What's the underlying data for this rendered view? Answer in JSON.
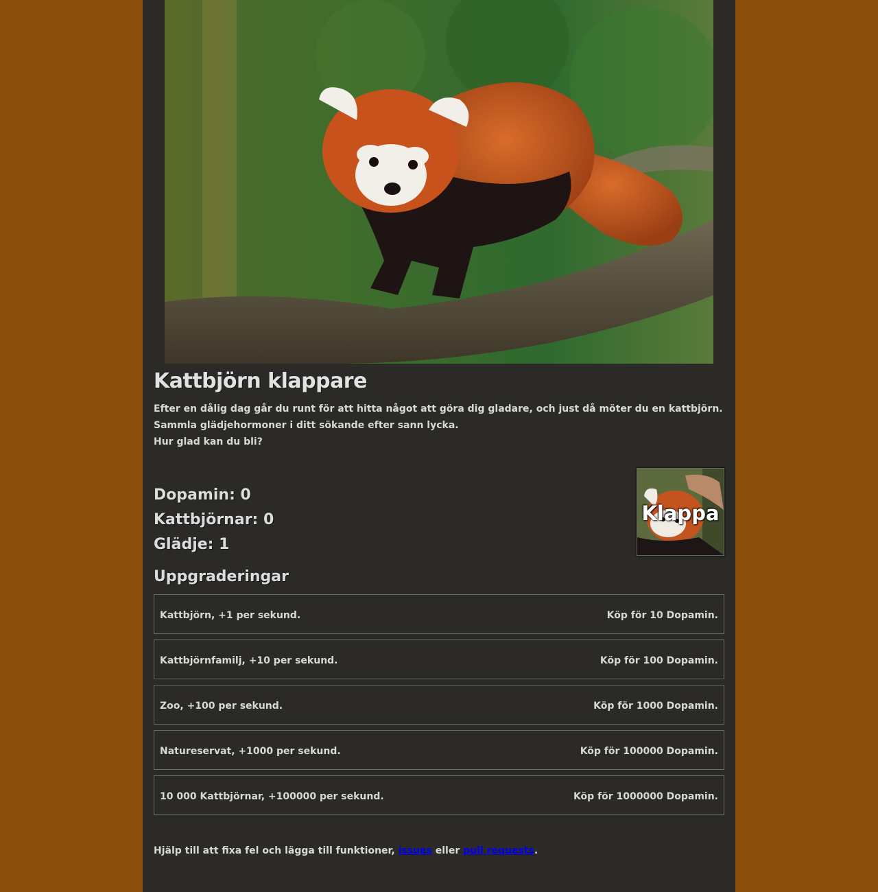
{
  "hero": {
    "image_description_icon": "red-panda-on-branch-photo"
  },
  "header": {
    "title": "Kattbjörn klappare"
  },
  "intro": {
    "lines": [
      "Efter en dålig dag går du runt för att hitta något att göra dig gladare, och just då möter du en kattbjörn.",
      "Sammla glädjehormoner i ditt sökande efter sann lycka.",
      "Hur glad kan du bli?"
    ]
  },
  "stats": {
    "dopamin": "Dopamin: 0",
    "kattbjornar": "Kattbjörnar: 0",
    "gladje": "Glädje: 1"
  },
  "pet_button": {
    "label": "Klappa"
  },
  "upgrades": {
    "title": "Uppgraderingar",
    "items": [
      {
        "name": "Kattbjörn, +1 per sekund.",
        "price": "Köp för 10 Dopamin."
      },
      {
        "name": "Kattbjörnfamilj, +10 per sekund.",
        "price": "Köp för 100 Dopamin."
      },
      {
        "name": "Zoo, +100 per sekund.",
        "price": "Köp för 1000 Dopamin."
      },
      {
        "name": "Natureservat, +1000 per sekund.",
        "price": "Köp för 100000 Dopamin."
      },
      {
        "name": "10 000 Kattbjörnar, +100000 per sekund.",
        "price": "Köp för 1000000 Dopamin."
      }
    ]
  },
  "footer": {
    "text_before": "Hjälp till att fixa fel och lägga till funktioner, ",
    "issues_link": "issues",
    "text_middle": " eller ",
    "pr_link": "pull requests",
    "text_after": "."
  },
  "colors": {
    "background": "#8a4e0c",
    "panel": "#2c2a27",
    "text": "#dcdcdc",
    "link": "#0000ee"
  }
}
